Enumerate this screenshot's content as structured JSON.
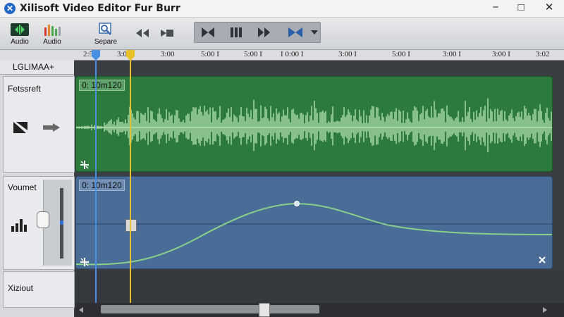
{
  "app": {
    "title": "Xilisoft Video Editor Fur Burr",
    "icon": "x-logo-icon",
    "window_buttons": [
      "−",
      "□",
      "✕"
    ]
  },
  "toolbar": {
    "items": [
      {
        "label": "Audio",
        "icon": "audio-green-icon"
      },
      {
        "label": "Audio",
        "icon": "audio-levels-icon"
      },
      {
        "label": "Separe",
        "icon": "search-zoom-icon"
      }
    ],
    "icons": [
      "rewind-icon",
      "stop-icon",
      "previous-icon",
      "pause-icon",
      "play-icon",
      "split-icon",
      "dropdown-icon"
    ]
  },
  "ruler": {
    "ticks": [
      "2:50",
      "3:04",
      "3:00",
      "5:00 I",
      "5:00 I",
      "I 0:00 I",
      "3:00 I",
      "5:00 I",
      "3:00 I",
      "3:00 I",
      "3:02"
    ]
  },
  "left_panel": {
    "header": "LGLIMAA+",
    "tracks": [
      {
        "label": "Fetssreft"
      },
      {
        "label": "Voumet"
      },
      {
        "label": "Xiziout"
      }
    ]
  },
  "lanes": [
    {
      "time": "0: 10m120",
      "color": "#2c7b3d",
      "wave": "#a6d7a3"
    },
    {
      "time": "0: 10m120",
      "color": "#4a6d98",
      "curve": "#86d08a"
    }
  ],
  "colors": {
    "playhead_blue": "#4a90e2",
    "playhead_yellow": "#e8c02a"
  }
}
